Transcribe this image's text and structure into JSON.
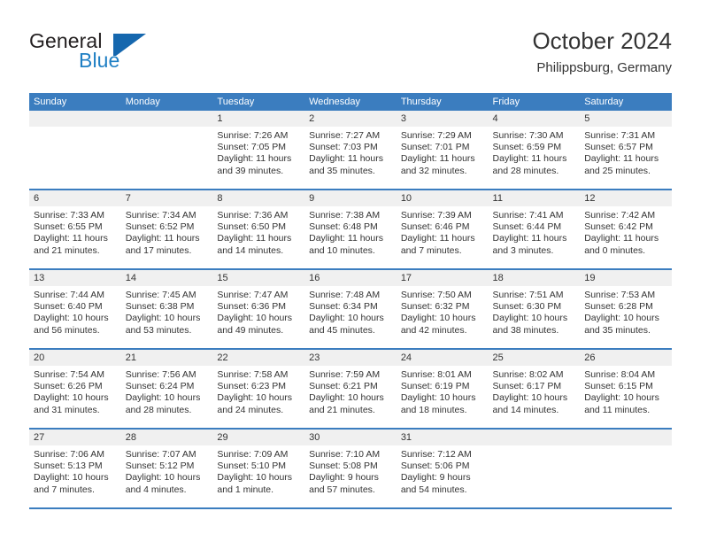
{
  "brand": {
    "name_part1": "General",
    "name_part2": "Blue",
    "flag_color": "#1567ae",
    "blue_color": "#1f7fc4"
  },
  "header": {
    "title": "October 2024",
    "subtitle": "Philippsburg, Germany"
  },
  "theme": {
    "header_row_bg": "#3b7dbf",
    "day_head_bg": "#f0f0f0",
    "text_color": "#333333"
  },
  "calendar": {
    "day_names": [
      "Sunday",
      "Monday",
      "Tuesday",
      "Wednesday",
      "Thursday",
      "Friday",
      "Saturday"
    ],
    "weeks": [
      [
        {
          "date": "",
          "sunrise": "",
          "sunset": "",
          "daylight": "",
          "empty": true
        },
        {
          "date": "",
          "sunrise": "",
          "sunset": "",
          "daylight": "",
          "empty": true
        },
        {
          "date": "1",
          "sunrise": "Sunrise: 7:26 AM",
          "sunset": "Sunset: 7:05 PM",
          "daylight": "Daylight: 11 hours and 39 minutes."
        },
        {
          "date": "2",
          "sunrise": "Sunrise: 7:27 AM",
          "sunset": "Sunset: 7:03 PM",
          "daylight": "Daylight: 11 hours and 35 minutes."
        },
        {
          "date": "3",
          "sunrise": "Sunrise: 7:29 AM",
          "sunset": "Sunset: 7:01 PM",
          "daylight": "Daylight: 11 hours and 32 minutes."
        },
        {
          "date": "4",
          "sunrise": "Sunrise: 7:30 AM",
          "sunset": "Sunset: 6:59 PM",
          "daylight": "Daylight: 11 hours and 28 minutes."
        },
        {
          "date": "5",
          "sunrise": "Sunrise: 7:31 AM",
          "sunset": "Sunset: 6:57 PM",
          "daylight": "Daylight: 11 hours and 25 minutes."
        }
      ],
      [
        {
          "date": "6",
          "sunrise": "Sunrise: 7:33 AM",
          "sunset": "Sunset: 6:55 PM",
          "daylight": "Daylight: 11 hours and 21 minutes."
        },
        {
          "date": "7",
          "sunrise": "Sunrise: 7:34 AM",
          "sunset": "Sunset: 6:52 PM",
          "daylight": "Daylight: 11 hours and 17 minutes."
        },
        {
          "date": "8",
          "sunrise": "Sunrise: 7:36 AM",
          "sunset": "Sunset: 6:50 PM",
          "daylight": "Daylight: 11 hours and 14 minutes."
        },
        {
          "date": "9",
          "sunrise": "Sunrise: 7:38 AM",
          "sunset": "Sunset: 6:48 PM",
          "daylight": "Daylight: 11 hours and 10 minutes."
        },
        {
          "date": "10",
          "sunrise": "Sunrise: 7:39 AM",
          "sunset": "Sunset: 6:46 PM",
          "daylight": "Daylight: 11 hours and 7 minutes."
        },
        {
          "date": "11",
          "sunrise": "Sunrise: 7:41 AM",
          "sunset": "Sunset: 6:44 PM",
          "daylight": "Daylight: 11 hours and 3 minutes."
        },
        {
          "date": "12",
          "sunrise": "Sunrise: 7:42 AM",
          "sunset": "Sunset: 6:42 PM",
          "daylight": "Daylight: 11 hours and 0 minutes."
        }
      ],
      [
        {
          "date": "13",
          "sunrise": "Sunrise: 7:44 AM",
          "sunset": "Sunset: 6:40 PM",
          "daylight": "Daylight: 10 hours and 56 minutes."
        },
        {
          "date": "14",
          "sunrise": "Sunrise: 7:45 AM",
          "sunset": "Sunset: 6:38 PM",
          "daylight": "Daylight: 10 hours and 53 minutes."
        },
        {
          "date": "15",
          "sunrise": "Sunrise: 7:47 AM",
          "sunset": "Sunset: 6:36 PM",
          "daylight": "Daylight: 10 hours and 49 minutes."
        },
        {
          "date": "16",
          "sunrise": "Sunrise: 7:48 AM",
          "sunset": "Sunset: 6:34 PM",
          "daylight": "Daylight: 10 hours and 45 minutes."
        },
        {
          "date": "17",
          "sunrise": "Sunrise: 7:50 AM",
          "sunset": "Sunset: 6:32 PM",
          "daylight": "Daylight: 10 hours and 42 minutes."
        },
        {
          "date": "18",
          "sunrise": "Sunrise: 7:51 AM",
          "sunset": "Sunset: 6:30 PM",
          "daylight": "Daylight: 10 hours and 38 minutes."
        },
        {
          "date": "19",
          "sunrise": "Sunrise: 7:53 AM",
          "sunset": "Sunset: 6:28 PM",
          "daylight": "Daylight: 10 hours and 35 minutes."
        }
      ],
      [
        {
          "date": "20",
          "sunrise": "Sunrise: 7:54 AM",
          "sunset": "Sunset: 6:26 PM",
          "daylight": "Daylight: 10 hours and 31 minutes."
        },
        {
          "date": "21",
          "sunrise": "Sunrise: 7:56 AM",
          "sunset": "Sunset: 6:24 PM",
          "daylight": "Daylight: 10 hours and 28 minutes."
        },
        {
          "date": "22",
          "sunrise": "Sunrise: 7:58 AM",
          "sunset": "Sunset: 6:23 PM",
          "daylight": "Daylight: 10 hours and 24 minutes."
        },
        {
          "date": "23",
          "sunrise": "Sunrise: 7:59 AM",
          "sunset": "Sunset: 6:21 PM",
          "daylight": "Daylight: 10 hours and 21 minutes."
        },
        {
          "date": "24",
          "sunrise": "Sunrise: 8:01 AM",
          "sunset": "Sunset: 6:19 PM",
          "daylight": "Daylight: 10 hours and 18 minutes."
        },
        {
          "date": "25",
          "sunrise": "Sunrise: 8:02 AM",
          "sunset": "Sunset: 6:17 PM",
          "daylight": "Daylight: 10 hours and 14 minutes."
        },
        {
          "date": "26",
          "sunrise": "Sunrise: 8:04 AM",
          "sunset": "Sunset: 6:15 PM",
          "daylight": "Daylight: 10 hours and 11 minutes."
        }
      ],
      [
        {
          "date": "27",
          "sunrise": "Sunrise: 7:06 AM",
          "sunset": "Sunset: 5:13 PM",
          "daylight": "Daylight: 10 hours and 7 minutes."
        },
        {
          "date": "28",
          "sunrise": "Sunrise: 7:07 AM",
          "sunset": "Sunset: 5:12 PM",
          "daylight": "Daylight: 10 hours and 4 minutes."
        },
        {
          "date": "29",
          "sunrise": "Sunrise: 7:09 AM",
          "sunset": "Sunset: 5:10 PM",
          "daylight": "Daylight: 10 hours and 1 minute."
        },
        {
          "date": "30",
          "sunrise": "Sunrise: 7:10 AM",
          "sunset": "Sunset: 5:08 PM",
          "daylight": "Daylight: 9 hours and 57 minutes."
        },
        {
          "date": "31",
          "sunrise": "Sunrise: 7:12 AM",
          "sunset": "Sunset: 5:06 PM",
          "daylight": "Daylight: 9 hours and 54 minutes."
        },
        {
          "date": "",
          "sunrise": "",
          "sunset": "",
          "daylight": "",
          "empty": true
        },
        {
          "date": "",
          "sunrise": "",
          "sunset": "",
          "daylight": "",
          "empty": true
        }
      ]
    ]
  }
}
